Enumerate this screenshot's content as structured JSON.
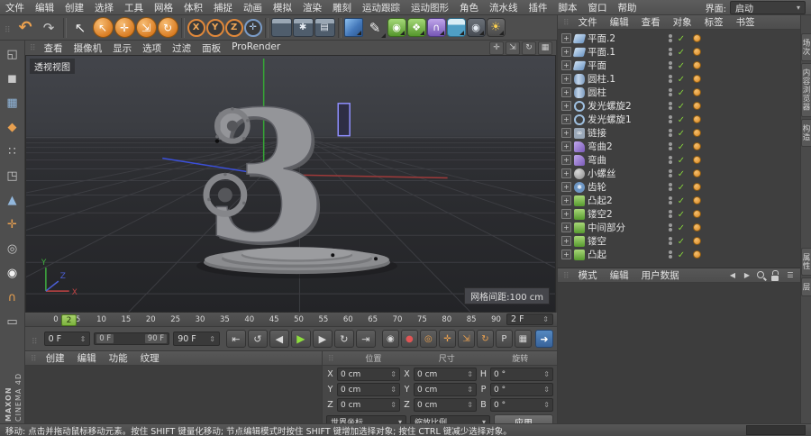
{
  "menubar": {
    "items": [
      "文件",
      "编辑",
      "创建",
      "选择",
      "工具",
      "网格",
      "体积",
      "捕捉",
      "动画",
      "模拟",
      "渲染",
      "雕刻",
      "运动跟踪",
      "运动图形",
      "角色",
      "流水线",
      "插件",
      "脚本",
      "窗口",
      "帮助"
    ],
    "interface_label": "界面:",
    "interface_value": "启动"
  },
  "toolbar": {
    "tools": [
      {
        "name": "undo-icon",
        "glyph": "↶",
        "cls": "fg-or"
      },
      {
        "name": "redo-icon",
        "glyph": "↷",
        "cls": "fg-gray"
      },
      {
        "name": "separator",
        "glyph": "",
        "cls": "sep"
      },
      {
        "name": "selection-cursor-icon",
        "glyph": "↖",
        "cls": "fg-w"
      },
      {
        "name": "live-selection-icon",
        "glyph": "↖",
        "cls": "circ-or"
      },
      {
        "name": "move-tool-icon",
        "glyph": "✛",
        "cls": "circ-or"
      },
      {
        "name": "scale-tool-icon",
        "glyph": "⇲",
        "cls": "circ-or"
      },
      {
        "name": "rotate-tool-icon",
        "glyph": "↻",
        "cls": "circ-or"
      },
      {
        "name": "separator",
        "glyph": "",
        "cls": "sep"
      },
      {
        "name": "x-axis-lock-icon",
        "glyph": "X",
        "cls": "circ-dk"
      },
      {
        "name": "y-axis-lock-icon",
        "glyph": "Y",
        "cls": "circ-dk"
      },
      {
        "name": "z-axis-lock-icon",
        "glyph": "Z",
        "cls": "circ-dk"
      },
      {
        "name": "coordinate-system-icon",
        "glyph": "✛",
        "cls": "circ-dk ring-blue"
      },
      {
        "name": "separator",
        "glyph": "",
        "cls": "sep"
      },
      {
        "name": "render-view-icon",
        "glyph": "",
        "cls": "clapper"
      },
      {
        "name": "render-settings-icon",
        "glyph": "✱",
        "cls": "clapper"
      },
      {
        "name": "render-queue-icon",
        "glyph": "▤",
        "cls": "clapper"
      },
      {
        "name": "separator",
        "glyph": "",
        "cls": "sep"
      },
      {
        "name": "primitive-cube-icon",
        "glyph": "",
        "cls": "cube corner"
      },
      {
        "name": "spline-pen-icon",
        "glyph": "✎",
        "cls": "fg-w corner"
      },
      {
        "name": "subdivision-surface-icon",
        "glyph": "◉",
        "cls": "gen corner"
      },
      {
        "name": "generator-array-icon",
        "glyph": "❖",
        "cls": "gen corner"
      },
      {
        "name": "deformer-bend-icon",
        "glyph": "∩",
        "cls": "purp corner"
      },
      {
        "name": "environment-floor-icon",
        "glyph": "",
        "cls": "teal corner"
      },
      {
        "name": "camera-icon",
        "glyph": "◉",
        "cls": "cam corner"
      },
      {
        "name": "light-icon",
        "glyph": "☀",
        "cls": "bulb corner"
      }
    ]
  },
  "left_toolbar": {
    "tools": [
      {
        "name": "make-editable-icon",
        "glyph": "◱",
        "cls": "lt-gray"
      },
      {
        "name": "model-mode-icon",
        "glyph": "◼",
        "cls": "lt-gray"
      },
      {
        "name": "texture-mode-icon",
        "glyph": "▦",
        "cls": "lt-blue"
      },
      {
        "name": "workplane-mode-icon",
        "glyph": "◆",
        "cls": "lt-orange"
      },
      {
        "name": "points-mode-icon",
        "glyph": "∷",
        "cls": "lt-gray"
      },
      {
        "name": "edges-mode-icon",
        "glyph": "◳",
        "cls": "lt-gray"
      },
      {
        "name": "polygons-mode-icon",
        "glyph": "▲",
        "cls": "lt-blue"
      },
      {
        "name": "enable-axis-icon",
        "glyph": "✛",
        "cls": "lt-orange"
      },
      {
        "name": "viewport-solo-icon",
        "glyph": "◎",
        "cls": "lt-gray"
      },
      {
        "name": "mouse-move-icon",
        "glyph": "◉",
        "cls": "lt-white"
      },
      {
        "name": "snap-icon",
        "glyph": "∩",
        "cls": "lt-orange"
      },
      {
        "name": "quantize-icon",
        "glyph": "▭",
        "cls": "lt-gray"
      }
    ],
    "logo_line1": "MAXON",
    "logo_line2": "CINEMA 4D"
  },
  "viewport": {
    "menu": [
      "查看",
      "摄像机",
      "显示",
      "选项",
      "过滤",
      "面板",
      "ProRender"
    ],
    "view_icons": [
      {
        "name": "pan-view-icon",
        "glyph": "✛"
      },
      {
        "name": "zoom-view-icon",
        "glyph": "⇲"
      },
      {
        "name": "rotate-view-icon",
        "glyph": "↻"
      },
      {
        "name": "toggle-views-icon",
        "glyph": "▦"
      }
    ],
    "view_label": "透视视图",
    "grid_label": "网格间距:100 cm",
    "object_glyph": "3",
    "axis_x": "X",
    "axis_y": "Y",
    "axis_z": "Z"
  },
  "timeline": {
    "ticks": [
      "0",
      "5",
      "10",
      "15",
      "20",
      "25",
      "30",
      "35",
      "40",
      "45",
      "50",
      "55",
      "60",
      "65",
      "70",
      "75",
      "80",
      "85",
      "90"
    ],
    "playhead": "2",
    "current_frame": "2 F"
  },
  "transport": {
    "range_start": "0 F",
    "range_end": "90 F",
    "slider_start": "0 F",
    "slider_end": "90 F",
    "door_glyph": "➜",
    "buttons": [
      {
        "name": "goto-start-button",
        "glyph": "⇤",
        "cls": ""
      },
      {
        "name": "prev-key-button",
        "glyph": "↺",
        "cls": ""
      },
      {
        "name": "prev-frame-button",
        "glyph": "◀",
        "cls": ""
      },
      {
        "name": "play-button",
        "glyph": "▶",
        "cls": "play"
      },
      {
        "name": "next-frame-button",
        "glyph": "▶",
        "cls": ""
      },
      {
        "name": "next-key-button",
        "glyph": "↻",
        "cls": ""
      },
      {
        "name": "goto-end-button",
        "glyph": "⇥",
        "cls": ""
      }
    ],
    "record_buttons": [
      {
        "name": "record-keyframe-button",
        "glyph": "◉",
        "cls": ""
      },
      {
        "name": "autokey-button",
        "glyph": "●",
        "cls": "red-fg"
      },
      {
        "name": "keyframe-selection-button",
        "glyph": "◎",
        "cls": "or-fg"
      },
      {
        "name": "position-key-toggle",
        "glyph": "✛",
        "cls": "or-fg"
      },
      {
        "name": "scale-key-toggle",
        "glyph": "⇲",
        "cls": "or-fg"
      },
      {
        "name": "rotation-key-toggle",
        "glyph": "↻",
        "cls": "or-fg"
      },
      {
        "name": "parameter-key-toggle",
        "glyph": "P",
        "cls": ""
      },
      {
        "name": "pla-toggle",
        "glyph": "▦",
        "cls": ""
      }
    ]
  },
  "materials_panel": {
    "tabs": [
      "创建",
      "编辑",
      "功能",
      "纹理"
    ]
  },
  "coordinates": {
    "headers": [
      "位置",
      "尺寸",
      "旋转"
    ],
    "rows": [
      {
        "l1": "X",
        "v1": "0 cm",
        "l2": "X",
        "v2": "0 cm",
        "l3": "H",
        "v3": "0 °"
      },
      {
        "l1": "Y",
        "v1": "0 cm",
        "l2": "Y",
        "v2": "0 cm",
        "l3": "P",
        "v3": "0 °"
      },
      {
        "l1": "Z",
        "v1": "0 cm",
        "l2": "Z",
        "v2": "0 cm",
        "l3": "B",
        "v3": "0 °"
      }
    ],
    "dropdown_left": "世界坐标",
    "dropdown_mid": "缩放比例",
    "apply_label": "应用"
  },
  "object_manager": {
    "menu": [
      "文件",
      "编辑",
      "查看",
      "对象",
      "标签",
      "书签"
    ],
    "rows": [
      {
        "name": "平面.2",
        "icon": "plane",
        "icon_name": "plane-icon"
      },
      {
        "name": "平面.1",
        "icon": "plane",
        "icon_name": "plane-icon"
      },
      {
        "name": "平面",
        "icon": "plane",
        "icon_name": "plane-icon"
      },
      {
        "name": "圆柱.1",
        "icon": "cylinder",
        "icon_name": "cylinder-icon"
      },
      {
        "name": "圆柱",
        "icon": "cylinder",
        "icon_name": "cylinder-icon"
      },
      {
        "name": "发光螺旋2",
        "icon": "spiral",
        "icon_name": "spiral-icon"
      },
      {
        "name": "发光螺旋1",
        "icon": "spiral",
        "icon_name": "spiral-icon"
      },
      {
        "name": "链接",
        "icon": "link",
        "icon_name": "link-icon"
      },
      {
        "name": "弯曲2",
        "icon": "bend",
        "icon_name": "bend-icon"
      },
      {
        "name": "弯曲",
        "icon": "bend",
        "icon_name": "bend-icon"
      },
      {
        "name": "小螺丝",
        "icon": "screw",
        "icon_name": "screw-icon"
      },
      {
        "name": "齿轮",
        "icon": "gear",
        "icon_name": "gear-icon"
      },
      {
        "name": "凸起2",
        "icon": "green",
        "icon_name": "generator-icon"
      },
      {
        "name": "镂空2",
        "icon": "green",
        "icon_name": "generator-icon"
      },
      {
        "name": "中间部分",
        "icon": "green",
        "icon_name": "generator-icon"
      },
      {
        "name": "镂空",
        "icon": "green",
        "icon_name": "generator-icon"
      },
      {
        "name": "凸起",
        "icon": "green",
        "icon_name": "generator-icon"
      }
    ]
  },
  "attributes_manager": {
    "menu": [
      "模式",
      "编辑",
      "用户数据"
    ],
    "icons": [
      {
        "name": "back-icon",
        "glyph": "◀",
        "cls": ""
      },
      {
        "name": "forward-icon",
        "glyph": "▶",
        "cls": ""
      },
      {
        "name": "search-icon",
        "glyph": "",
        "cls": "css-search"
      },
      {
        "name": "lock-icon",
        "glyph": "",
        "cls": "css-lock"
      },
      {
        "name": "menu-icon",
        "glyph": "☰",
        "cls": ""
      }
    ]
  },
  "right_tabs": {
    "top": [
      "场次",
      "内容浏览器",
      "构造"
    ],
    "bottom": [
      "属性",
      "层"
    ]
  },
  "statusbar": {
    "text": "移动: 点击并拖动鼠标移动元素。按住 SHIFT 键量化移动; 节点编辑模式时按住 SHIFT 键增加选择对象; 按住 CTRL 键减少选择对象。"
  }
}
